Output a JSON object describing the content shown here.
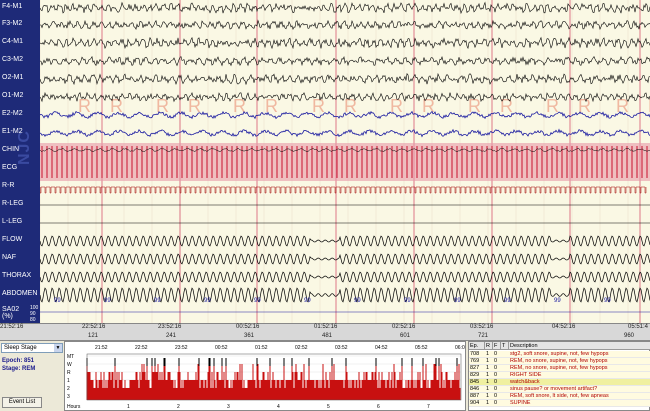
{
  "channels": [
    "F4-M1",
    "F3-M2",
    "C4-M1",
    "C3-M2",
    "O2-M1",
    "O1-M2",
    "E2-M2",
    "E1-M2",
    "CHIN",
    "ECG",
    "R-R",
    "R-LEG",
    "L-LEG",
    "FLOW",
    "NAF",
    "THORAX",
    "ABDOMEN",
    "SA02\n(%)"
  ],
  "sao2_scale": [
    "100",
    "90",
    "80"
  ],
  "watermark": "NJC",
  "stage_marker": "R",
  "sao2_values": [
    "99",
    "99",
    "99",
    "99",
    "99",
    "99",
    "99",
    "99",
    "99",
    "99",
    "99",
    "99"
  ],
  "time_ticks": [
    "21:52:16",
    "22:52:16",
    "23:52:16",
    "00:52:16",
    "01:52:16",
    "02:52:16",
    "03:52:16",
    "04:52:16",
    "05:51:4"
  ],
  "epoch_ticks": [
    "121",
    "241",
    "361",
    "481",
    "601",
    "721",
    "960"
  ],
  "left_panel": {
    "selector": "Sleep Stage",
    "epoch_label": "Epoch: 851",
    "stage_label": "Stage: REM",
    "event_button": "Event List"
  },
  "hypnogram": {
    "axis_labels": [
      "MT",
      "W",
      "R",
      "1",
      "2",
      "3"
    ],
    "top_times": [
      "21:52",
      "22:52",
      "23:52",
      "00:52",
      "01:52",
      "02:52",
      "03:52",
      "04:52",
      "05:52",
      "06:0"
    ],
    "hours_label": "Hours",
    "hours": [
      "1",
      "2",
      "3",
      "4",
      "5",
      "6",
      "7"
    ]
  },
  "events_table": {
    "headers": [
      "Ep.",
      "R",
      "F",
      "T",
      "Description"
    ],
    "rows": [
      {
        "ep": "708",
        "r": "1",
        "f": "0",
        "desc": "stg2, soft snore, supine, not, few hypops"
      },
      {
        "ep": "769",
        "r": "1",
        "f": "0",
        "desc": "REM, no snore, supine, not, few hypops"
      },
      {
        "ep": "827",
        "r": "1",
        "f": "0",
        "desc": "REM, no snore, supine, not, few hypops"
      },
      {
        "ep": "829",
        "r": "1",
        "f": "0",
        "desc": "RIGHT SIDE"
      },
      {
        "ep": "845",
        "r": "1",
        "f": "0",
        "desc": "watch&back"
      },
      {
        "ep": "846",
        "r": "1",
        "f": "0",
        "desc": "sinus pause? or movement artifact?"
      },
      {
        "ep": "887",
        "r": "1",
        "f": "0",
        "desc": "REM, soft snore, lt side, not, few apneas"
      },
      {
        "ep": "904",
        "r": "1",
        "f": "0",
        "desc": "SUPINE"
      }
    ]
  },
  "colors": {
    "label_panel": "#1e2a78",
    "trace": "#000000",
    "eog_trace": "#1a1aa0",
    "ecg_band": "#c8102e",
    "rem_marker": "#f0b8a0",
    "hypno_fill": "#c81010"
  }
}
